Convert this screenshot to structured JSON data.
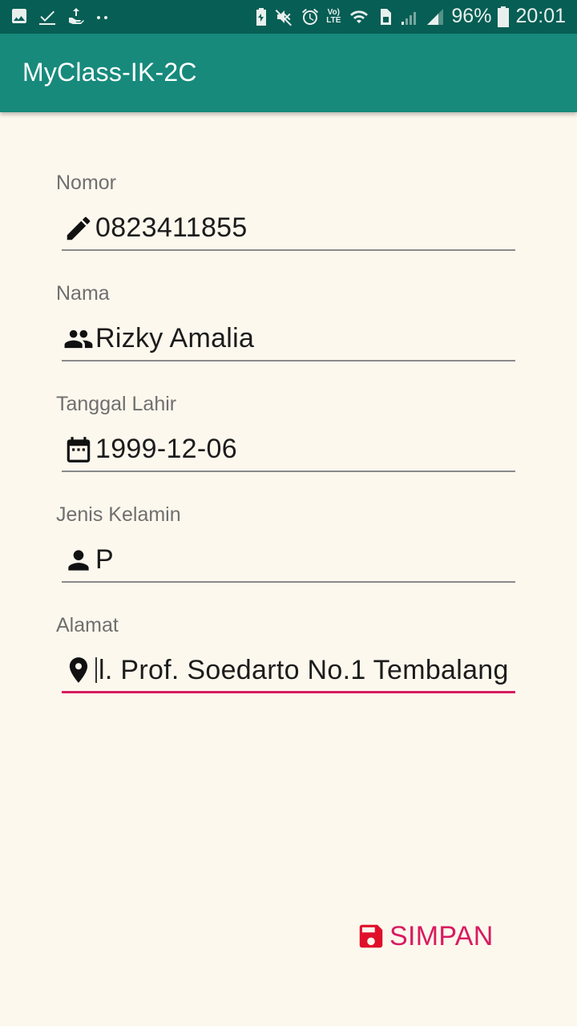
{
  "status_bar": {
    "battery": "96%",
    "time": "20:01",
    "lte_top": "Vo)",
    "lte_bottom": "LTE"
  },
  "app": {
    "title": "MyClass-IK-2C"
  },
  "form": {
    "nomor": {
      "label": "Nomor",
      "value": "0823411855",
      "icon": "edit-icon"
    },
    "nama": {
      "label": "Nama",
      "value": "Rizky Amalia",
      "icon": "people-icon"
    },
    "tanggal_lahir": {
      "label": "Tanggal Lahir",
      "value": "1999-12-06",
      "icon": "calendar-icon"
    },
    "jenis_kelamin": {
      "label": "Jenis Kelamin",
      "value": "P",
      "icon": "person-icon"
    },
    "alamat": {
      "label": "Alamat",
      "value": "l. Prof. Soedarto No.1 Tembalang",
      "icon": "location-pin-icon"
    }
  },
  "actions": {
    "save_label": "SIMPAN",
    "save_icon": "floppy-disk-icon"
  },
  "colors": {
    "status_bar": "#075e54",
    "app_bar": "#178a7c",
    "background": "#fdf8ee",
    "accent": "#d81b60",
    "save_icon": "#e0102a"
  }
}
